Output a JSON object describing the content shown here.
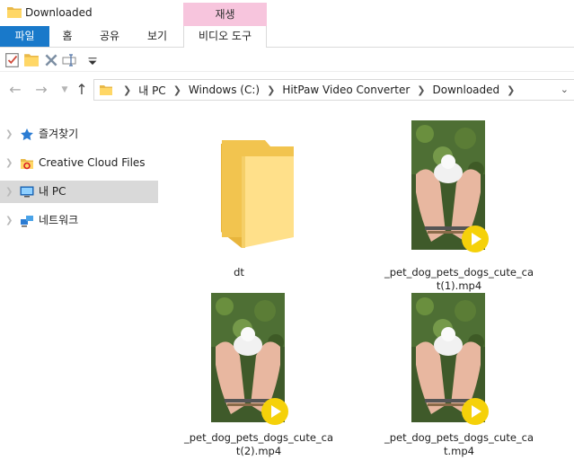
{
  "window": {
    "title": "Downloaded"
  },
  "ribbon": {
    "context_group": "재생",
    "tabs": [
      {
        "label": "파일",
        "active": true
      },
      {
        "label": "홈"
      },
      {
        "label": "공유"
      },
      {
        "label": "보기"
      },
      {
        "label": "비디오 도구"
      }
    ]
  },
  "quick_access": {
    "icons": [
      "properties-check-icon",
      "new-folder-icon",
      "delete-icon",
      "rename-icon",
      "customize-dropdown-icon"
    ]
  },
  "address": {
    "crumbs": [
      "내 PC",
      "Windows (C:)",
      "HitPaw Video Converter",
      "Downloaded"
    ]
  },
  "navpane": {
    "items": [
      {
        "label": "즐겨찾기",
        "icon": "star-icon"
      },
      {
        "label": "Creative Cloud Files",
        "icon": "creative-cloud-icon"
      },
      {
        "label": "내 PC",
        "icon": "computer-icon",
        "selected": true
      },
      {
        "label": "네트워크",
        "icon": "network-icon"
      }
    ]
  },
  "files": [
    {
      "name": "dt",
      "type": "folder"
    },
    {
      "name": "_pet_dog_pets_dogs_cute_cat(1).mp4",
      "type": "video"
    },
    {
      "name": "_pet_dog_pets_dogs_cute_cat(2).mp4",
      "type": "video"
    },
    {
      "name": "_pet_dog_pets_dogs_cute_cat.mp4",
      "type": "video"
    }
  ],
  "colors": {
    "accent": "#1979ca",
    "context_tab": "#f7c5dd",
    "selection": "#d9d9d9",
    "play_button": "#f5d10a"
  }
}
